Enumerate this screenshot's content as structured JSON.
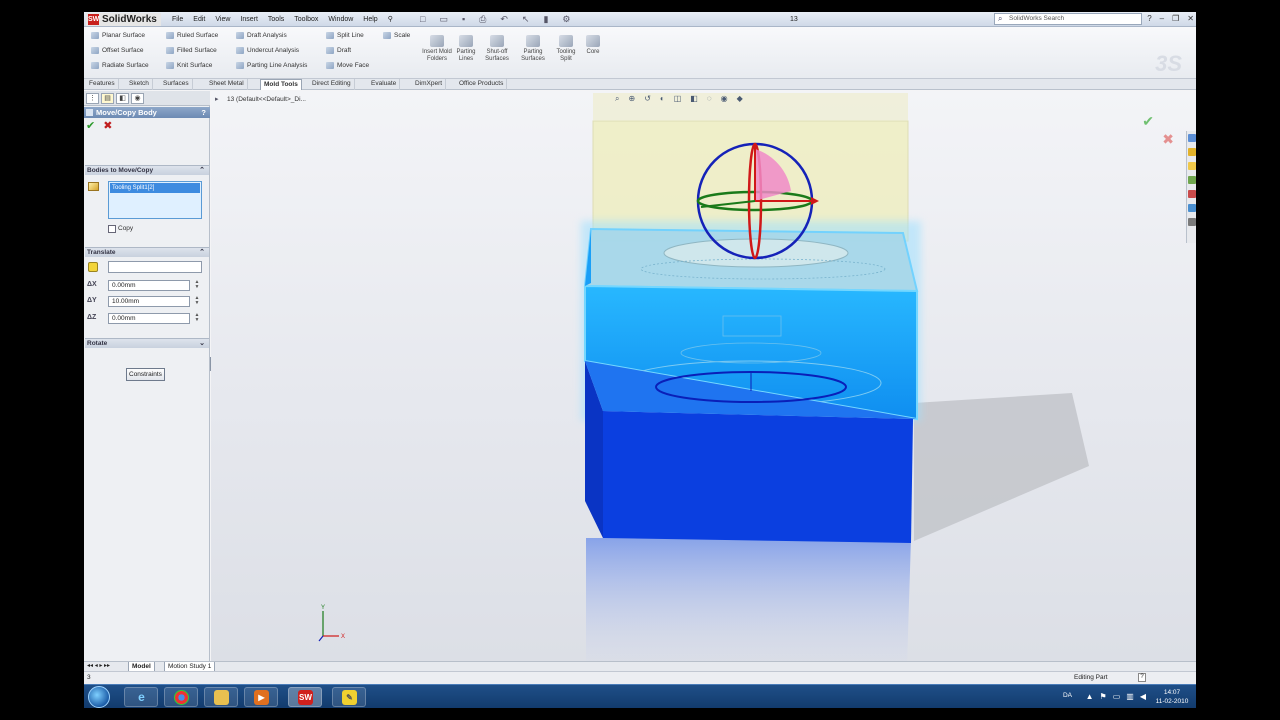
{
  "app": {
    "brand": "SolidWorks",
    "logo": "SW",
    "menus": [
      "File",
      "Edit",
      "View",
      "Insert",
      "Tools",
      "Toolbox",
      "Window",
      "Help"
    ],
    "doc_title": "13",
    "search_placeholder": "SolidWorks Search"
  },
  "commands": {
    "col1": [
      "Planar Surface",
      "Offset Surface",
      "Radiate Surface"
    ],
    "col2": [
      "Ruled Surface",
      "Filled Surface",
      "Knit Surface"
    ],
    "col3": [
      "Draft Analysis",
      "Undercut Analysis",
      "Parting Line Analysis"
    ],
    "col4": [
      "Split Line",
      "Draft",
      "Move Face"
    ],
    "col5": [
      "Scale"
    ],
    "big": [
      "Insert Mold Folders",
      "Parting Lines",
      "Shut-off Surfaces",
      "Parting Surfaces",
      "Tooling Split",
      "Core"
    ]
  },
  "tabs": [
    "Features",
    "Sketch",
    "Surfaces",
    "Sheet Metal",
    "Mold Tools",
    "Direct Editing",
    "Evaluate",
    "DimXpert",
    "Office Products"
  ],
  "active_tab": "Mold Tools",
  "property_manager": {
    "title": "Move/Copy Body",
    "help": "?",
    "ok": "✔",
    "cancel": "✖",
    "section_bodies": "Bodies to Move/Copy",
    "selected_body": "Tooling Split1[2]",
    "copy_label": "Copy",
    "section_translate": "Translate",
    "dx_label": "ΔX",
    "dy_label": "ΔY",
    "dz_label": "ΔZ",
    "dx": "0.00mm",
    "dy": "10.00mm",
    "dz": "0.00mm",
    "section_rotate": "Rotate",
    "constraints_button": "Constraints"
  },
  "viewport": {
    "feature_tree_item": "13  (Default<<Default>_Di..."
  },
  "bottom_tabs": [
    "Model",
    "Motion Study 1"
  ],
  "status": {
    "left": "3",
    "right": "Editing Part",
    "help": "?"
  },
  "taskbar": {
    "language": "DA",
    "time": "14:07",
    "date": "11-02-2010"
  },
  "colors": {
    "highlight_blue": "#1fa8ff",
    "body_blue": "#0b3fe0",
    "translucent_yellow": "#efeebb",
    "triad_red": "#d01818",
    "triad_green": "#1a7a1a",
    "triad_blue": "#1522b8"
  }
}
